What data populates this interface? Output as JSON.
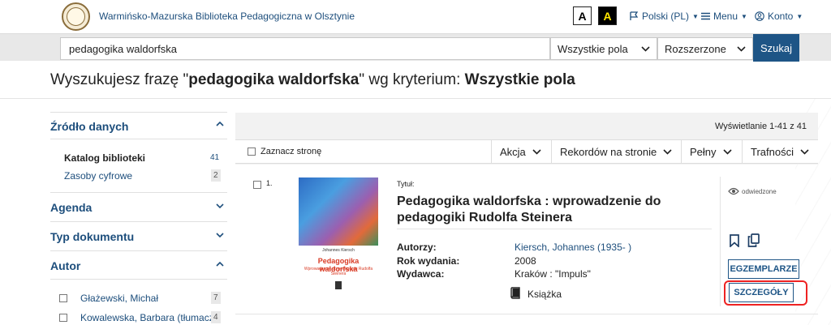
{
  "header": {
    "library_name": "Warmińsko-Mazurska Biblioteka Pedagogiczna w Olsztynie",
    "contrast_normal": "A",
    "contrast_high": "A",
    "language": "Polski (PL)",
    "menu": "Menu",
    "account": "Konto"
  },
  "search": {
    "query": "pedagogika waldorfska",
    "field_select": "Wszystkie pola",
    "mode_select": "Rozszerzone",
    "submit": "Szukaj"
  },
  "heading": {
    "prefix": "Wyszukujesz frazę \"",
    "phrase": "pedagogika waldorfska",
    "middle": "\" wg kryterium: ",
    "criterion": "Wszystkie pola"
  },
  "sidebar": {
    "source": {
      "title": "Źródło danych",
      "items": [
        {
          "label": "Katalog biblioteki",
          "count": "41"
        },
        {
          "label": "Zasoby cyfrowe",
          "count": "2"
        }
      ]
    },
    "agenda": {
      "title": "Agenda"
    },
    "doc_type": {
      "title": "Typ dokumentu"
    },
    "author": {
      "title": "Autor",
      "items": [
        {
          "label": "Głażewski, Michał",
          "count": "7"
        },
        {
          "label": "Kowalewska, Barbara (tłumacz)",
          "count": "4"
        }
      ]
    }
  },
  "results": {
    "display_range": "Wyświetlanie 1-41 z 41",
    "select_page": "Zaznacz stronę",
    "action": "Akcja",
    "per_page": "Rekordów na stronie",
    "view": "Pełny",
    "sort": "Trafności"
  },
  "record": {
    "number": "1.",
    "title_label": "Tytuł:",
    "title": "Pedagogika waldorfska : wprowadzenie do pedagogiki Rudolfa Steinera",
    "authors_label": "Autorzy:",
    "authors": "Kiersch, Johannes (1935- )",
    "year_label": "Rok wydania:",
    "year": "2008",
    "publisher_label": "Wydawca:",
    "publisher": "Kraków : \"Impuls\"",
    "format": "Książka",
    "visited": "odwiedzone",
    "copies_btn": "EGZEMPLARZE",
    "details_btn": "SZCZEGÓŁY",
    "cover_author": "Johannes Kiersch",
    "cover_title": "Pedagogika waldorfska",
    "cover_subtitle": "Wprowadzenie do pedagogiki Rudolfa Steinera"
  }
}
